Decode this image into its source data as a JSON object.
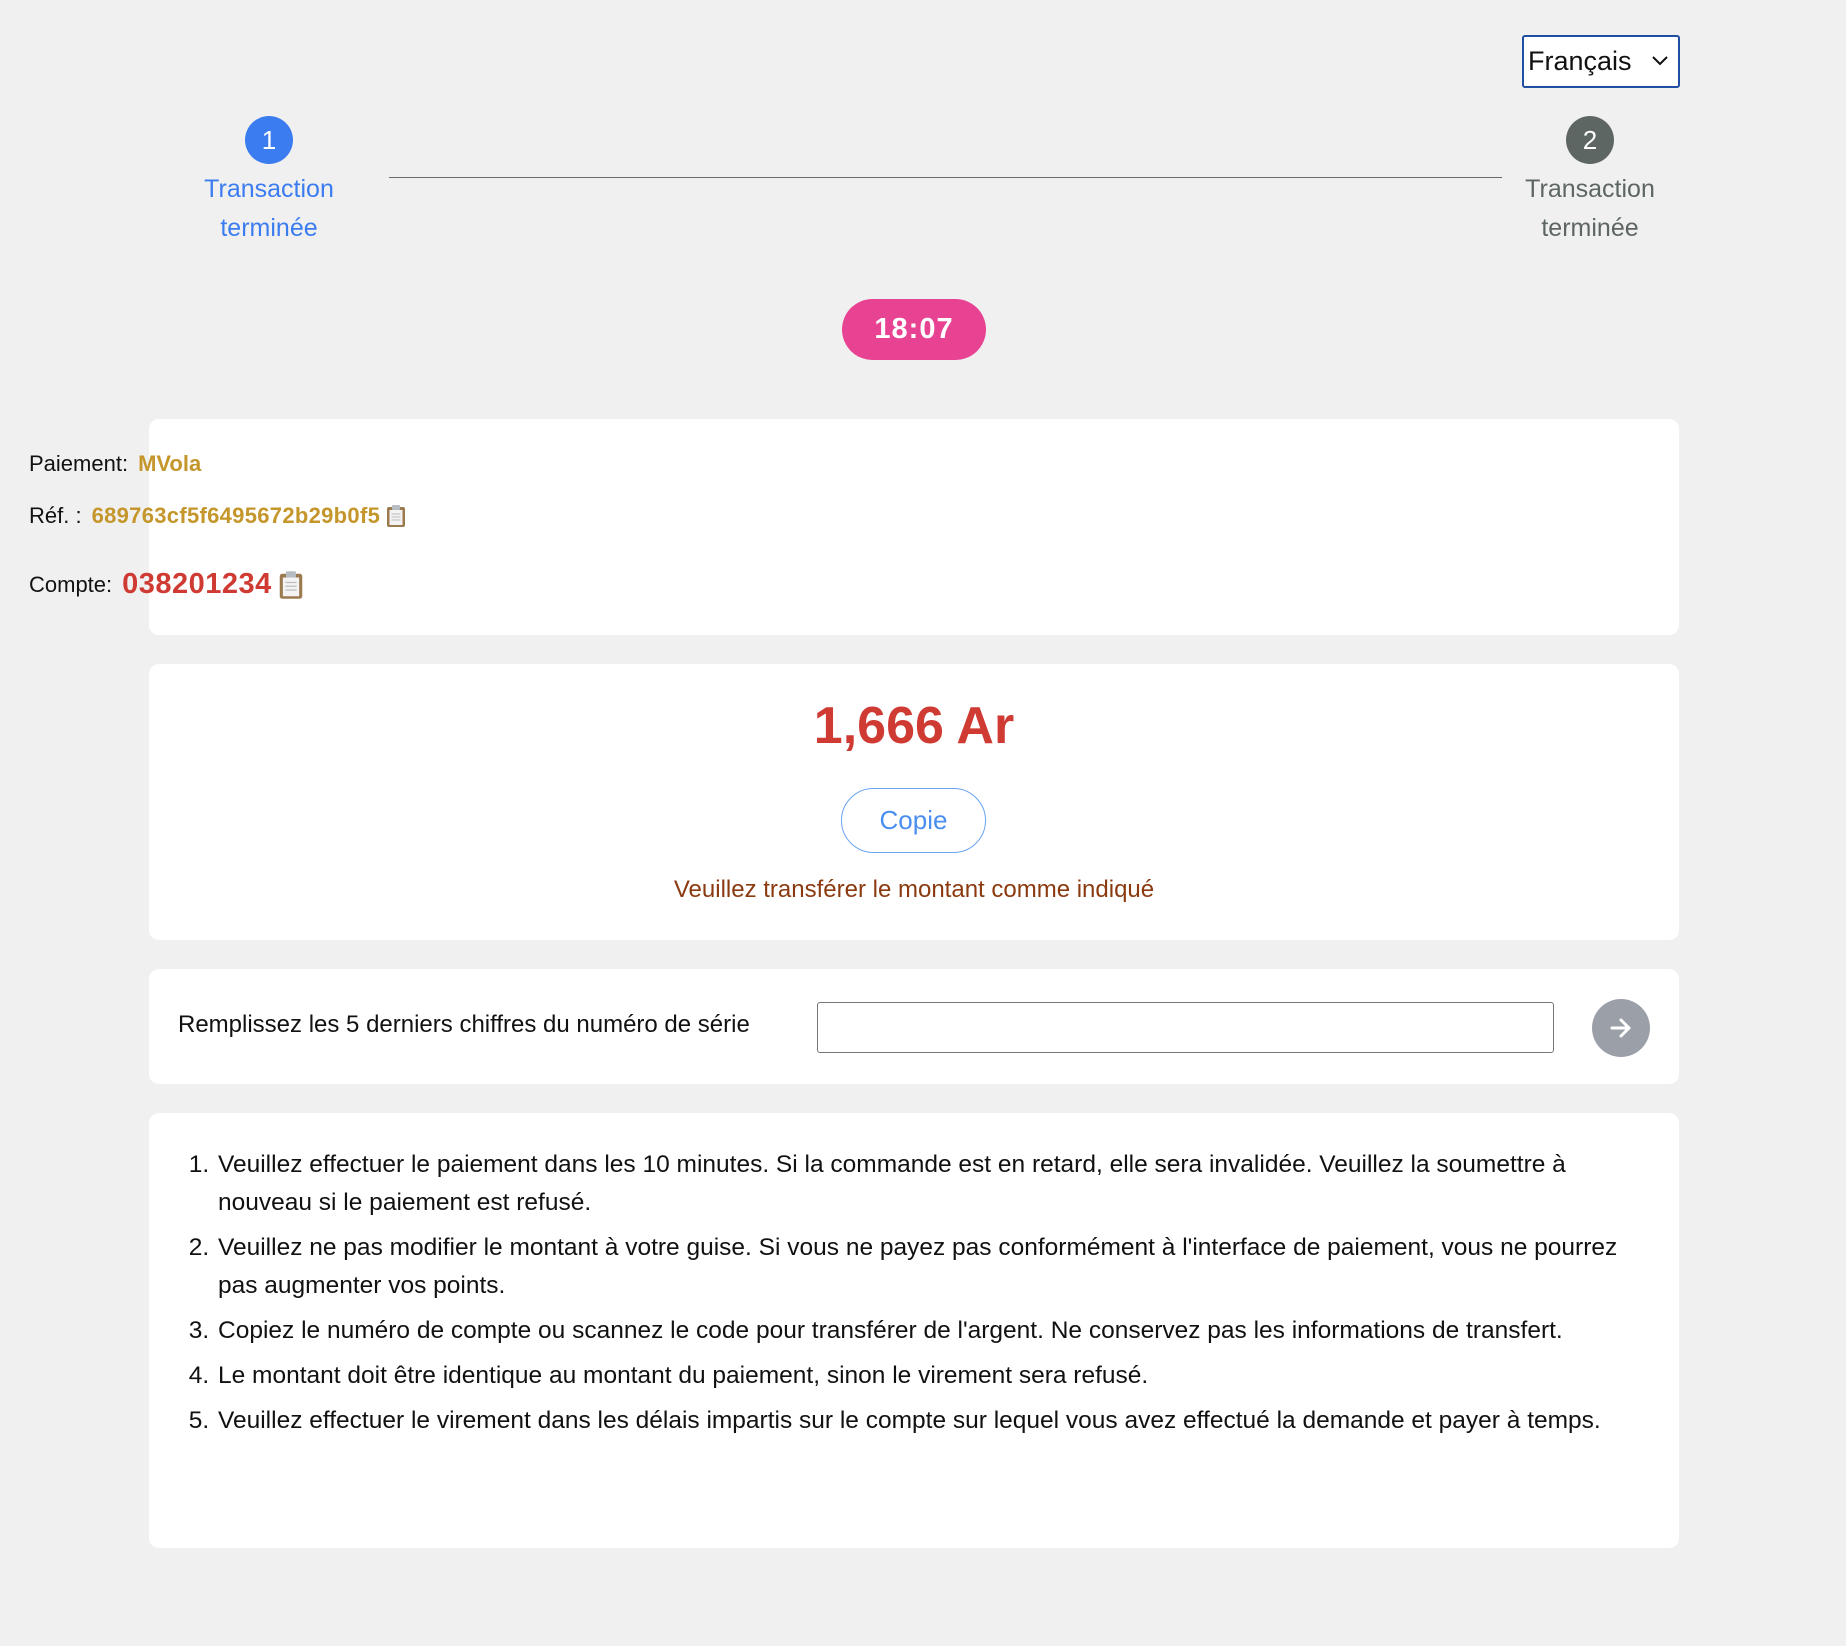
{
  "language_select": {
    "value": "Français"
  },
  "stepper": {
    "steps": [
      {
        "number": "1",
        "label": "Transaction terminée"
      },
      {
        "number": "2",
        "label": "Transaction terminée"
      }
    ]
  },
  "timer": {
    "value": "18:07"
  },
  "payment_info": {
    "payment_label": "Paiement:",
    "payment_value": "MVola",
    "ref_label": "Réf. :",
    "ref_value": "689763cf5f6495672b29b0f5",
    "account_label": "Compte:",
    "account_value": "038201234"
  },
  "amount_card": {
    "amount": "1,666 Ar",
    "copy_label": "Copie",
    "hint": "Veuillez transférer le montant comme indiqué"
  },
  "serial_card": {
    "label": "Remplissez les 5 derniers chiffres du numéro de série",
    "input_value": ""
  },
  "notes": [
    "Veuillez effectuer le paiement dans les 10 minutes. Si la commande est en retard, elle sera invalidée. Veuillez la soumettre à nouveau si le paiement est refusé.",
    "Veuillez ne pas modifier le montant à votre guise. Si vous ne payez pas conformément à l'interface de paiement, vous ne pourrez pas augmenter vos points.",
    "Copiez le numéro de compte ou scannez le code pour transférer de l'argent. Ne conservez pas les informations de transfert.",
    "Le montant doit être identique au montant du paiement, sinon le virement sera refusé.",
    "Veuillez effectuer le virement dans les délais impartis sur le compte sur lequel vous avez effectué la demande et payer à temps."
  ],
  "colors": {
    "primary_blue": "#3b7cf0",
    "timer_pink": "#e84393",
    "amount_red": "#cf3a33",
    "gold": "#c4962b",
    "hint_brown": "#8b3a10",
    "inactive_step": "#5d6663"
  },
  "icons": {
    "select_chevron": "chevron-down-icon",
    "copy": "clipboard-icon",
    "submit": "arrow-right-icon"
  }
}
